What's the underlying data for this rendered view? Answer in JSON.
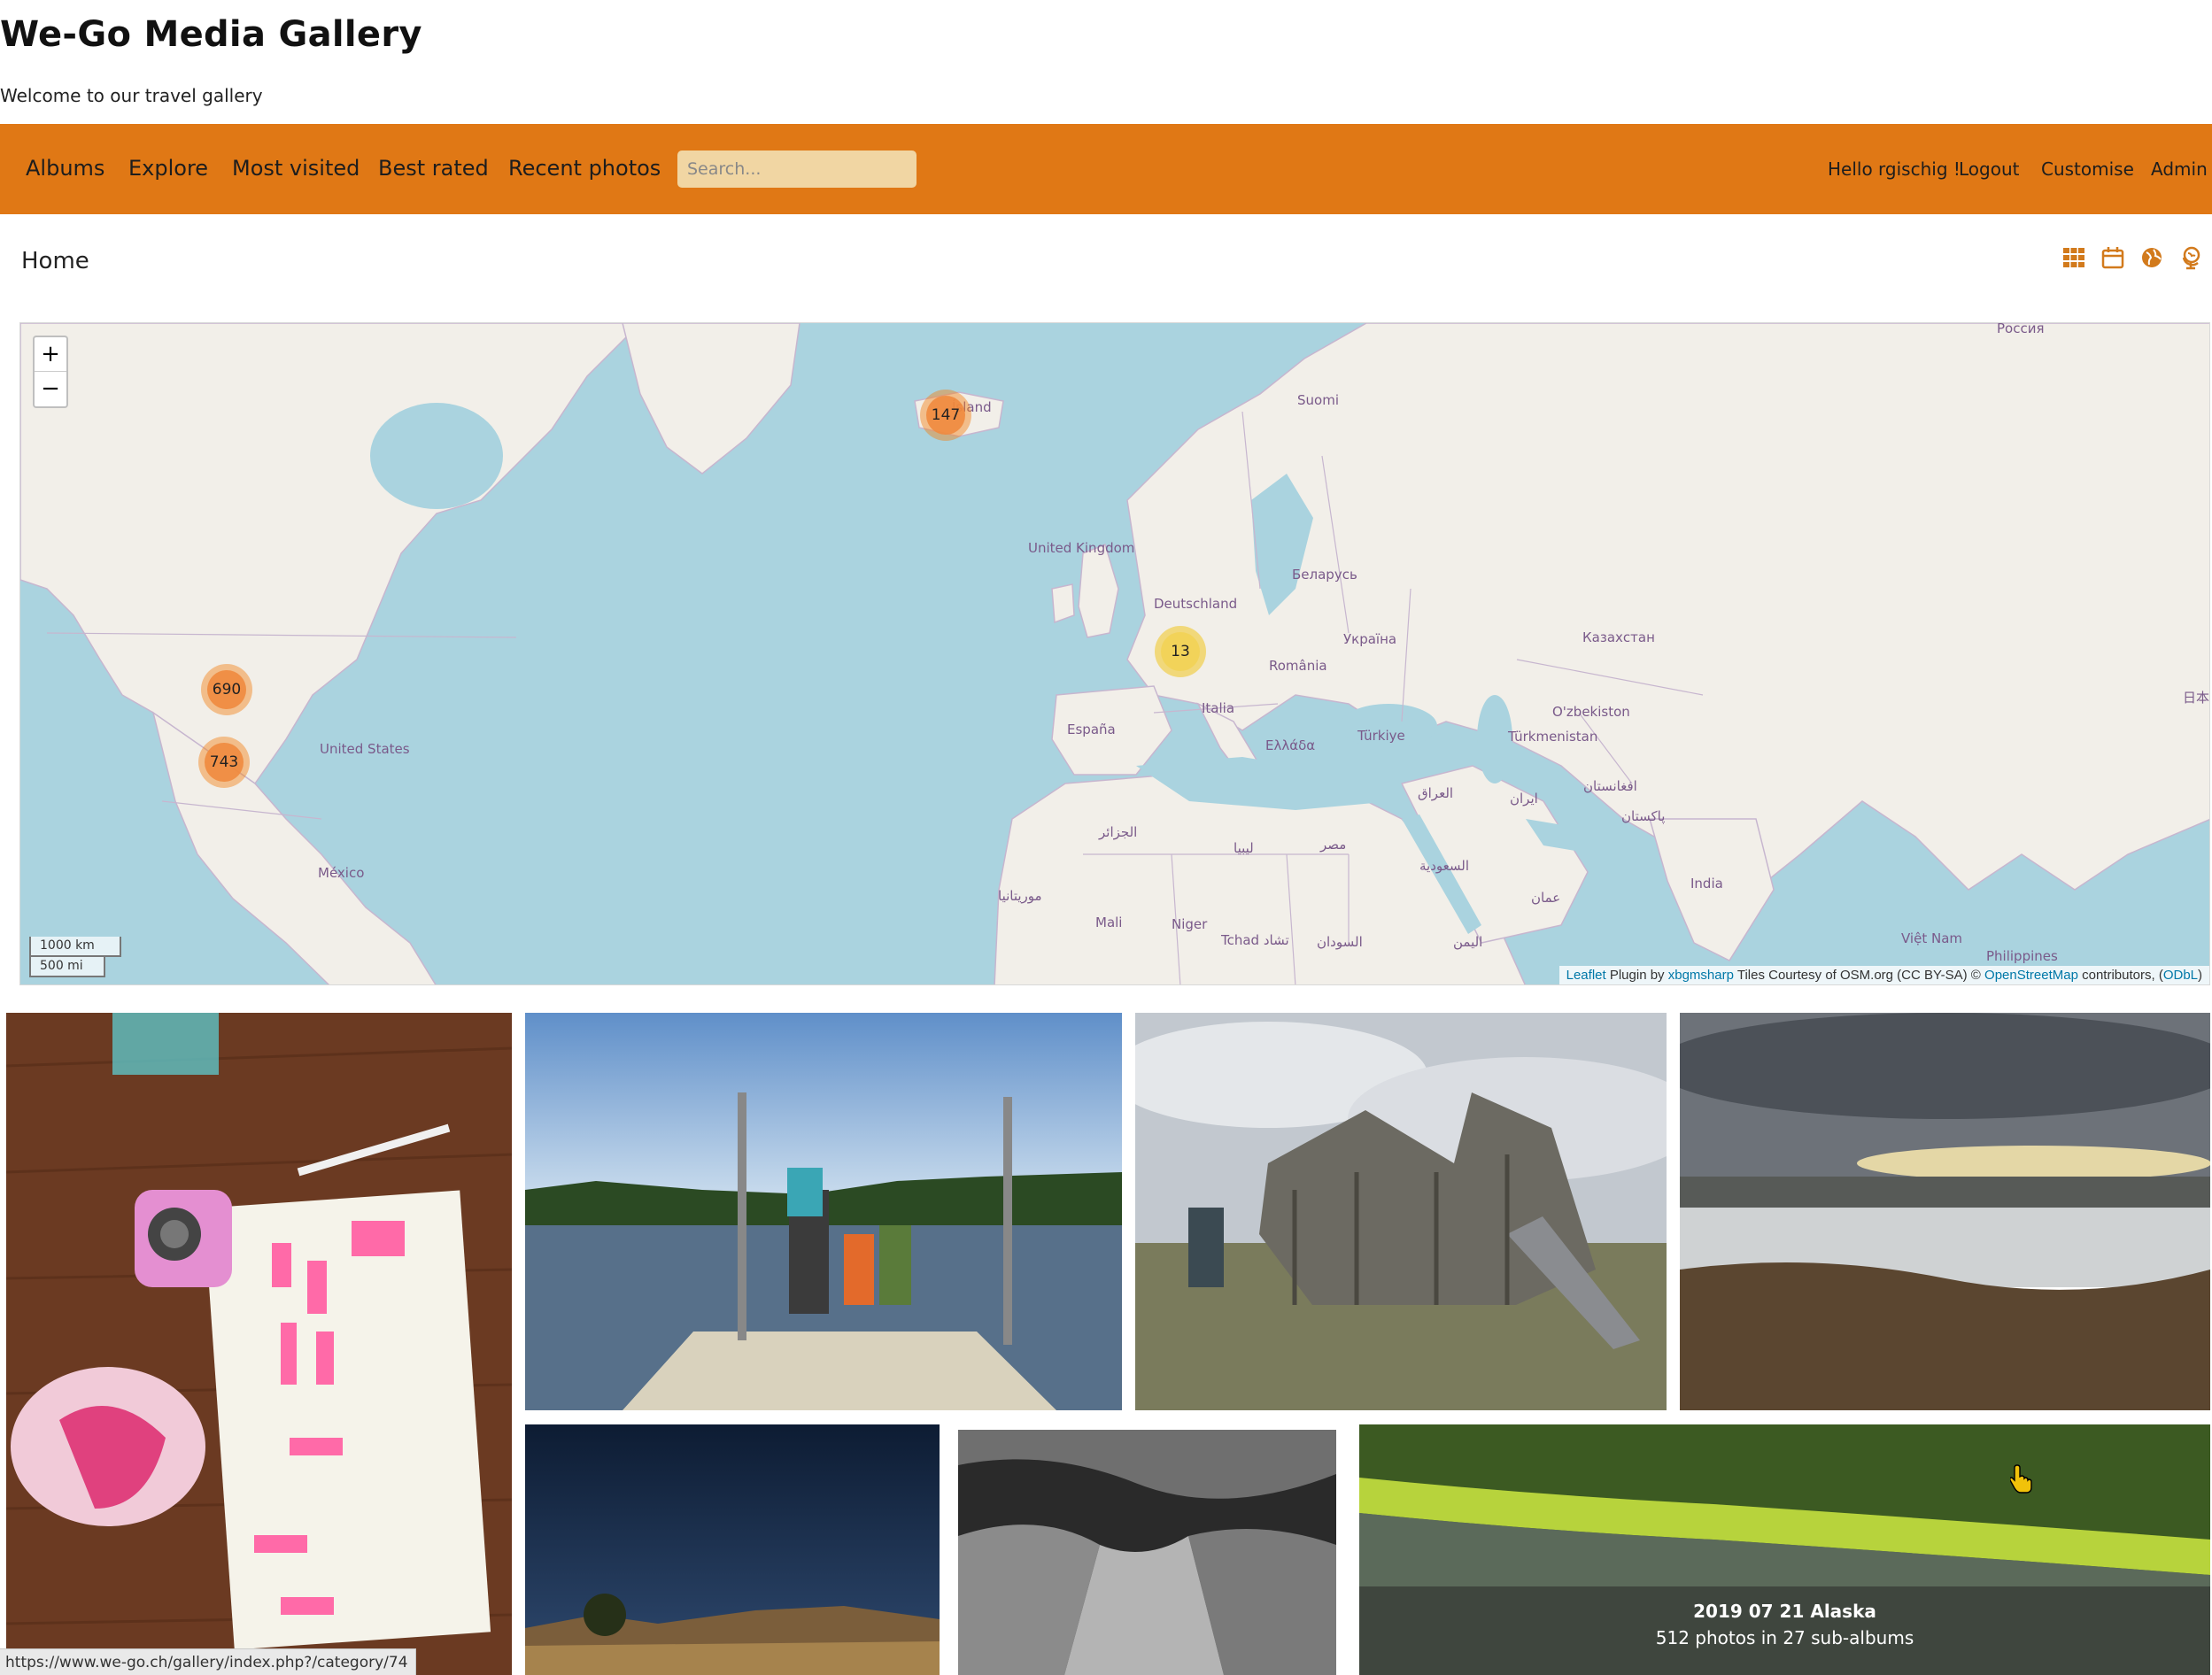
{
  "site": {
    "title": "We-Go Media Gallery",
    "tagline": "Welcome to our travel gallery"
  },
  "nav": {
    "items": [
      "Albums",
      "Explore",
      "Most visited",
      "Best rated",
      "Recent photos"
    ],
    "search_placeholder": "Search...",
    "greeting": "Hello rgischig !",
    "logout": "Logout",
    "customise": "Customise",
    "admin": "Admin",
    "background_color": "#e07815"
  },
  "breadcrumb": "Home",
  "view_icons": [
    "grid-icon",
    "calendar-icon",
    "globe-icon",
    "world-pin-icon"
  ],
  "map": {
    "zoom_in": "+",
    "zoom_out": "−",
    "clusters": [
      "147",
      "13",
      "690",
      "743"
    ],
    "labels": {
      "russia": "Россия",
      "suomi": "Suomi",
      "iceland": "Ísland",
      "uk": "United Kingdom",
      "belarus": "Беларусь",
      "deutschland": "Deutschland",
      "ukraine": "Україна",
      "kazakhstan": "Казахстан",
      "romania": "România",
      "italia": "Italia",
      "espana": "España",
      "ellada": "Ελλάδα",
      "turkiye": "Türkiye",
      "uzbekistan": "O'zbekiston",
      "turkmenistan": "Türkmenistan",
      "afghanistan": "افغانستان",
      "iraq": "العراق",
      "iran": "ایران",
      "pakistan": "پاکستان",
      "algeria": "الجزائر",
      "libya": "ليبيا",
      "egypt": "مصر",
      "saudi": "السعودية",
      "oman": "عمان",
      "india": "India",
      "mauritania": "موريتانيا",
      "mali": "Mali",
      "niger": "Niger",
      "tchad": "Tchad تشاد",
      "sudan": "السودان",
      "yemen": "اليمن",
      "vietnam": "Việt Nam",
      "philippines": "Philippines",
      "japan": "日本",
      "us": "United States",
      "mexico": "México"
    },
    "scale_km": "1000 km",
    "scale_mi": "500 mi",
    "attribution": {
      "leaflet": "Leaflet",
      "plugin_by": "Plugin by",
      "author": "xbgmsharp",
      "tiles": "Tiles Courtesy of OSM.org (CC BY-SA) ©",
      "osm": "OpenStreetMap",
      "contributors": "contributors, (",
      "odbl": "ODbL",
      "close": ")"
    }
  },
  "gallery": {
    "featured_album": {
      "title": "2019 07 21 Alaska",
      "subtitle": "512 photos in 27 sub-albums"
    }
  },
  "status_bar_url": "https://www.we-go.ch/gallery/index.php?/category/74"
}
